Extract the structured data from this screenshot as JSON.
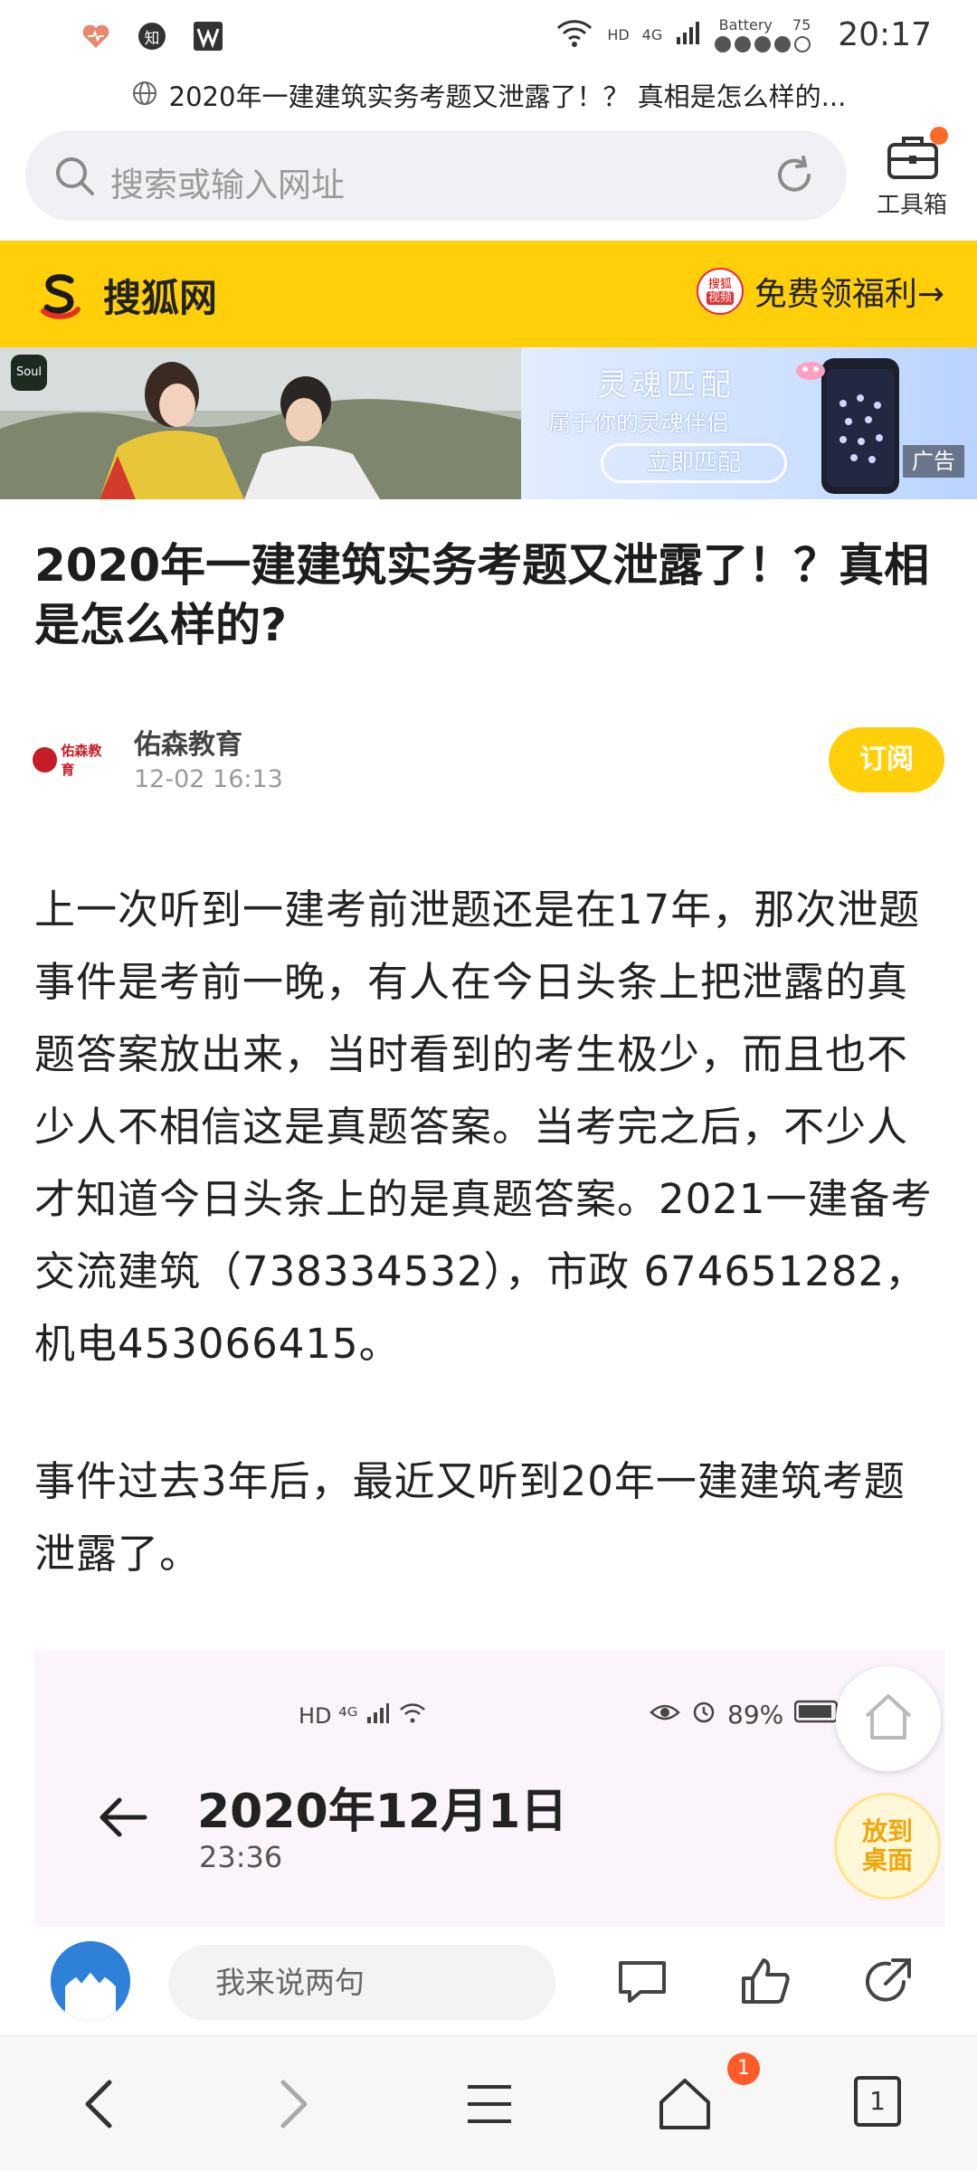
{
  "status_bar": {
    "icon_left_1": "heart-icon",
    "icon_left_2_text": "知",
    "icon_left_3": "wps-icon",
    "network_hd": "HD",
    "network_4g": "4G",
    "battery_label": "Battery",
    "battery_level": "75",
    "time": "20:17"
  },
  "tab_title": "2020年一建建筑实务考题又泄露了！？ 真相是怎么样的...",
  "search": {
    "placeholder": "搜索或输入网址"
  },
  "toolbox": {
    "label": "工具箱"
  },
  "site_header": {
    "name": "搜狐网",
    "benefit_badge_top": "搜狐",
    "benefit_badge_bottom": "视频",
    "benefit_label": "免费领福利→",
    "brand_color": "#ffd00a"
  },
  "ad": {
    "app_tag": "Soul",
    "title": "灵魂匹配",
    "subtitle": "属于你的灵魂伴侣",
    "cta": "立即匹配",
    "ad_label": "广告"
  },
  "article": {
    "title": "2020年一建建筑实务考题又泄露了！？真相是怎么样的?",
    "author_logo_text": "佑森教育",
    "author_name": "佑森教育",
    "publish_time": "12-02 16:13",
    "subscribe_label": "订阅",
    "paragraphs": [
      "上一次听到一建考前泄题还是在17年，那次泄题事件是考前一晚，有人在今日头条上把泄露的真题答案放出来，当时看到的考生极少，而且也不少人不相信这是真题答案。当考完之后，不少人才知道今日头条上的是真题答案。2021一建备考交流建筑（738334532），市政 674651282，机电453066415。",
      "事件过去3年后，最近又听到20年一建建筑考题泄露了。"
    ]
  },
  "embedded_screenshot": {
    "status_left": "HD ⁴ᴳ",
    "battery": "89%",
    "date": "2020年12月1日",
    "time": "23:36"
  },
  "floating": {
    "desktop_label_line1": "放到",
    "desktop_label_line2": "桌面"
  },
  "comment_bar": {
    "input_placeholder": "我来说两句"
  },
  "bottom_nav": {
    "home_badge": "1",
    "tabs_count": "1"
  }
}
